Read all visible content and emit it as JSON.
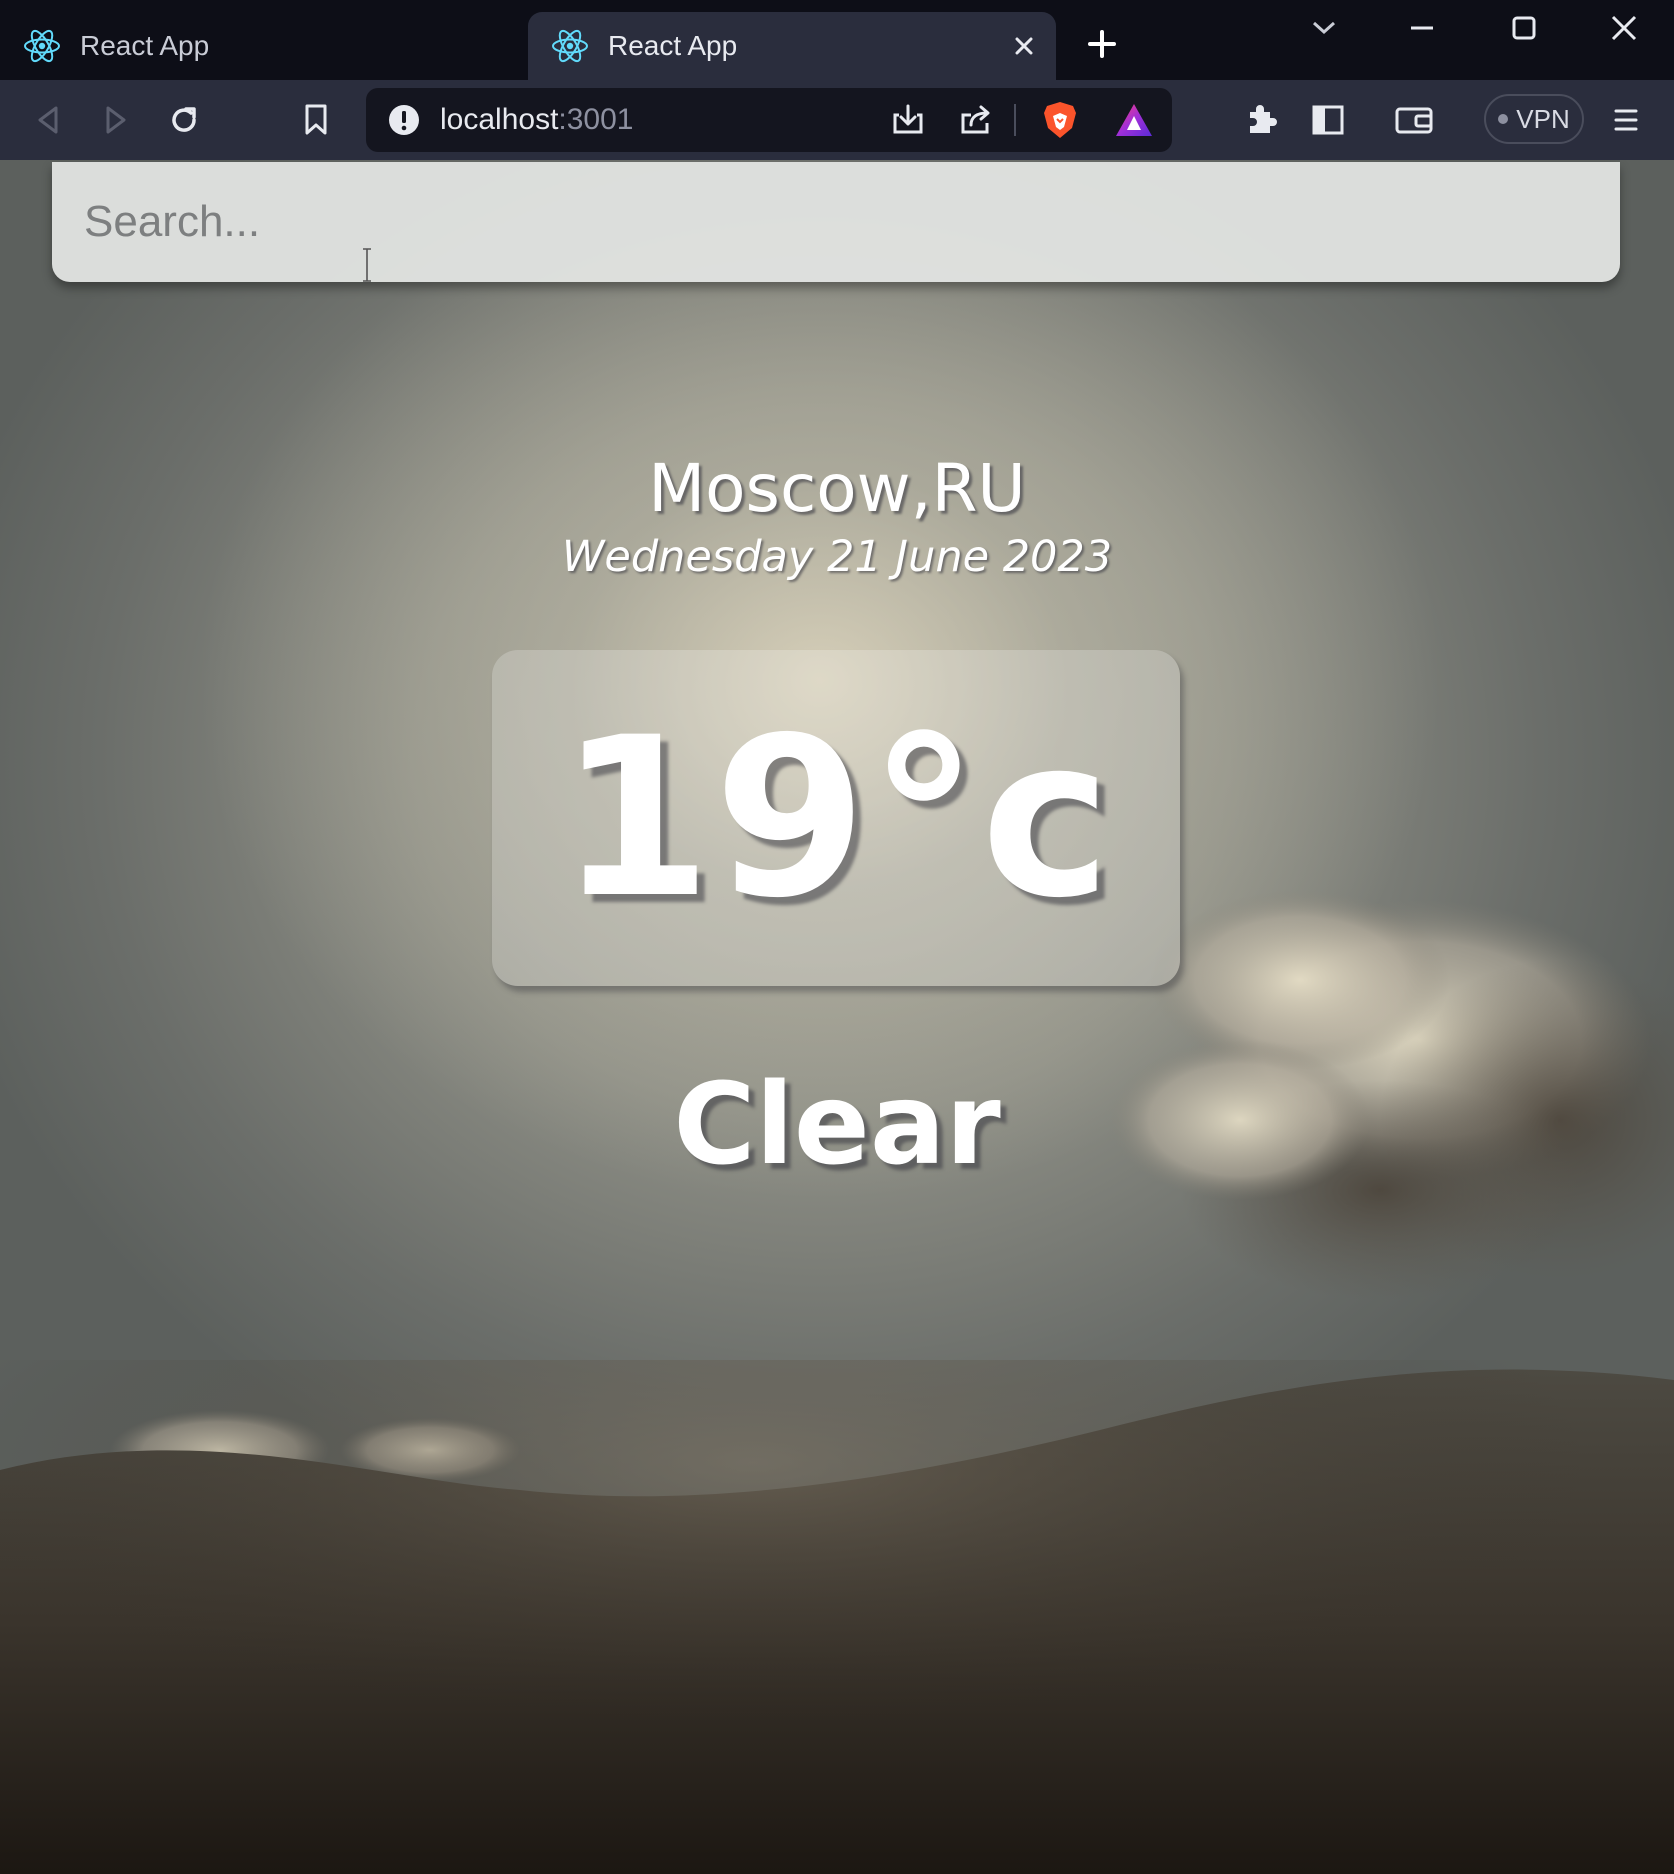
{
  "browser": {
    "tabs": [
      {
        "title": "React App",
        "active": false
      },
      {
        "title": "React App",
        "active": true
      }
    ],
    "address": {
      "host": "localhost",
      "port": ":3001"
    },
    "vpn_label": "VPN"
  },
  "search": {
    "placeholder": "Search...",
    "value": ""
  },
  "weather": {
    "location": "Moscow,RU",
    "date": "Wednesday 21 June 2023",
    "temperature": "19°c",
    "condition": "Clear"
  },
  "colors": {
    "tabstrip_bg": "#0d0e17",
    "toolbar_bg": "#2a2d3d",
    "omnibox_bg": "#14151f",
    "react_blue": "#61dafb",
    "brave_orange": "#fb542b",
    "text_white": "#ffffff"
  },
  "icons": {
    "favicon": "react-logo-icon",
    "back": "back-arrow-icon",
    "forward": "forward-arrow-icon",
    "reload": "reload-icon",
    "bookmark": "bookmark-icon",
    "site_info": "info-icon",
    "install": "install-icon",
    "share": "share-icon",
    "brave_shields": "brave-lion-icon",
    "brave_rewards": "rewards-triangle-icon",
    "extensions": "puzzle-icon",
    "sidebar": "sidebar-icon",
    "wallet": "wallet-icon",
    "menu": "hamburger-menu-icon"
  }
}
